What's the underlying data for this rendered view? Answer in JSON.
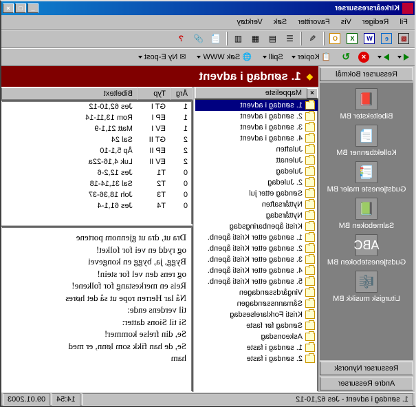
{
  "title": "Kirkeårsressurser",
  "title_btns": {
    "min": "_",
    "max": "□",
    "close": "×"
  },
  "menubar": [
    "Fil",
    "Rediger",
    "Vis",
    "Favoritter",
    "Søk",
    "Verktøy"
  ],
  "nav": {
    "stop": "×",
    "refresh": "↻",
    "copy": "Kopier",
    "search": "Søk WWW",
    "mail": "Ny E-post"
  },
  "sidebar": {
    "top": "Ressurser Bokmål",
    "items": [
      {
        "label": "Bibeltekster BM"
      },
      {
        "label": "Kollektbønner BM"
      },
      {
        "label": "Gudstjeneste maler BM"
      },
      {
        "label": "Salmeboken BM"
      },
      {
        "label": "Gudstjenesteboken BM"
      },
      {
        "label": "Liturgisk musikk BM"
      }
    ],
    "btn2": "Ressurser Nynorsk",
    "btn3": "Andre Ressurser"
  },
  "heading": "1. søndag i advent",
  "tree_header": "Mappeliste",
  "tree_close": "×",
  "tree": [
    "1. søndag i advent",
    "2. søndag i advent",
    "3. søndag i advent",
    "4. søndag i advent",
    "Julaften",
    "Julenatt",
    "Juledag",
    "2. Juledag",
    "Søndag etter jul",
    "Nyttårsaften",
    "Nyttårsdag",
    "Kristi åpenbaringsdag",
    "1. søndag etter Kristi åpenb.",
    "2. søndag etter Kristi åpenb.",
    "3. søndag etter Kristi åpenb.",
    "4. søndag etter Kristi åpenb.",
    "5. søndag etter Kristi åpenb.",
    "Vingårdssøndagen",
    "Såmannssøndagen",
    "Kristi Forklarelsesdag",
    "Søndag før faste",
    "Askeonsdag",
    "1. søndag i faste",
    "2. søndag i faste"
  ],
  "table": {
    "headers": {
      "arg": "Årg",
      "typ": "Typ",
      "bib": "Bibeltext"
    },
    "rows": [
      {
        "arg": "1",
        "typ": "GT I",
        "bib": "Jes 62,10-12"
      },
      {
        "arg": "1",
        "typ": "EP I",
        "bib": "Rom 13,11-14"
      },
      {
        "arg": "1",
        "typ": "EV I",
        "bib": "Matt 21,1-9"
      },
      {
        "arg": "2",
        "typ": "GT II",
        "bib": "Sal 24"
      },
      {
        "arg": "2",
        "typ": "EP II",
        "bib": "Åp 5,1-10"
      },
      {
        "arg": "2",
        "typ": "EV II",
        "bib": "Luk 4,16-22a"
      },
      {
        "arg": "0",
        "typ": "T1",
        "bib": "Jes 12,2-6"
      },
      {
        "arg": "0",
        "typ": "T2",
        "bib": "Sal 31,14-18"
      },
      {
        "arg": "0",
        "typ": "T3",
        "bib": "Joh 18,36-37"
      },
      {
        "arg": "0",
        "typ": "T4",
        "bib": "Jes 61,1-4"
      }
    ]
  },
  "text": {
    "lines": [
      "Dra ut, dra ut gjennom portene",
      "og rydd en vei for folket!",
      "Bygg, ja, bygg en kongevei",
      "og rens den vel for stein!",
      "Reis en merkestang for folkene!",
      "Nå lar Herren rope ut så det høres",
      "til verdens ende:",
      "Si til Sions datter:",
      "Se, din frelse kommer!",
      "Se, de han fikk som lønn, er med",
      "ham"
    ]
  },
  "status": {
    "left": "1. søndag i advent - Jes 62,10-12",
    "time": "14:54",
    "date": "09.01.2003"
  }
}
